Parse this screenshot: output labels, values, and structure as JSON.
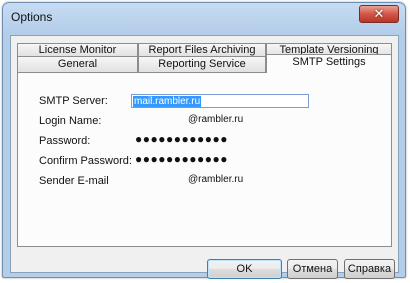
{
  "window": {
    "title": "Options",
    "close_glyph": "✕"
  },
  "tabs_back_row": [
    {
      "label": "License Monitor"
    },
    {
      "label": "Report Files Archiving"
    },
    {
      "label": "Template Versioning"
    }
  ],
  "tabs_front_row": [
    {
      "label": "General"
    },
    {
      "label": "Reporting Service"
    },
    {
      "label": "SMTP Settings"
    }
  ],
  "active_tab": "SMTP Settings",
  "smtp": {
    "server_label": "SMTP Server:",
    "server_value": "mail.rambler.ru",
    "login_label": "Login Name:",
    "login_value": "@rambler.ru",
    "password_label": "Password:",
    "password_value": "●●●●●●●●●●●●",
    "confirm_label": "Confirm Password:",
    "confirm_value": "●●●●●●●●●●●●",
    "sender_label": "Sender E-mail",
    "sender_value": "@rambler.ru"
  },
  "buttons": {
    "ok": "OK",
    "cancel": "Отмена",
    "help": "Справка"
  },
  "icons": {
    "close": "close-icon"
  }
}
